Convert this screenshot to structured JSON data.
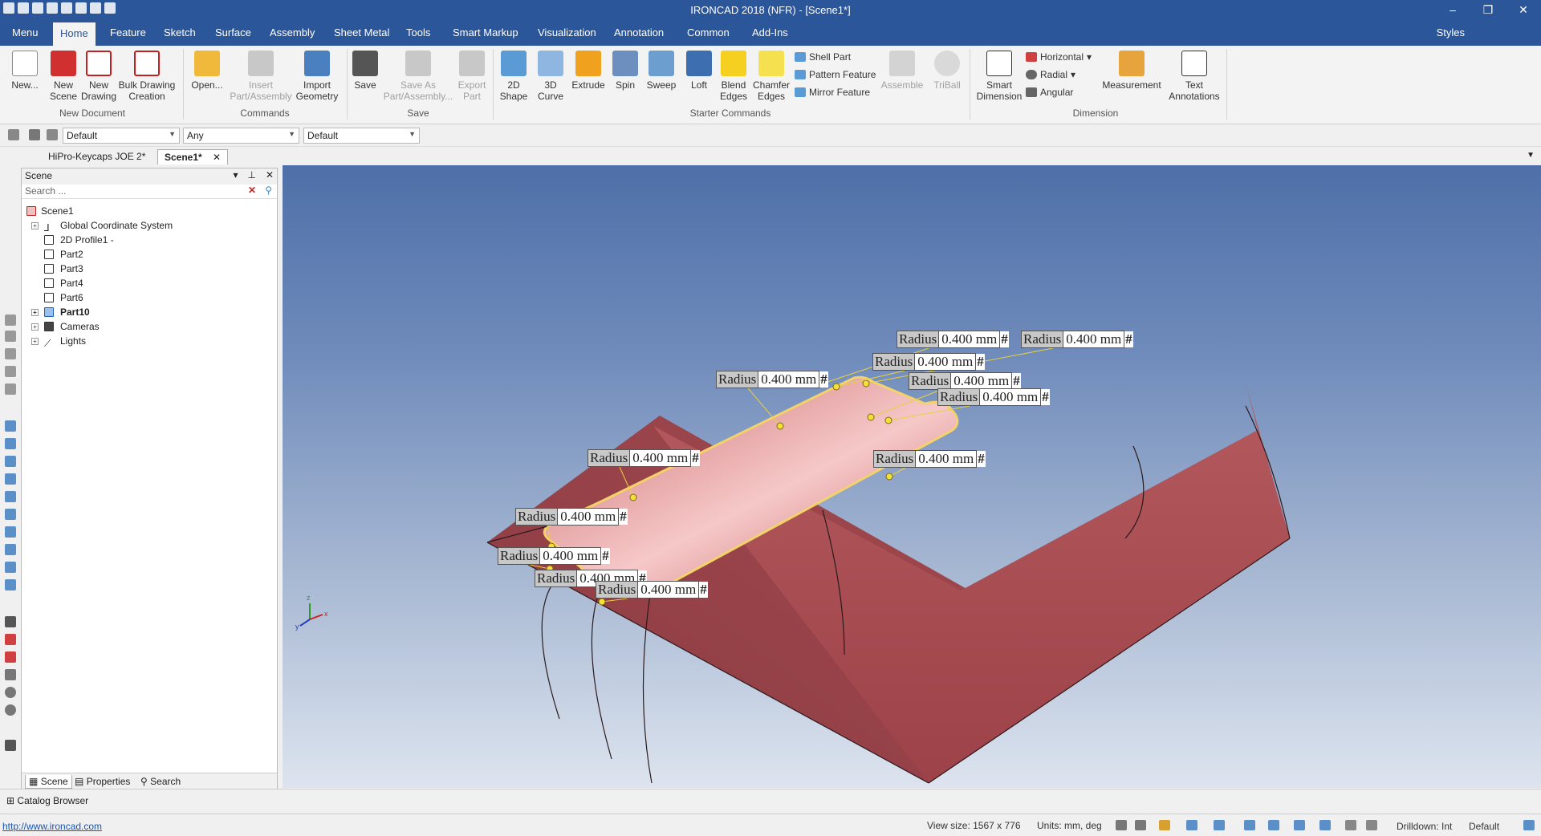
{
  "window": {
    "title": "IRONCAD 2018 (NFR) - [Scene1*]",
    "controls": [
      "–",
      "❐",
      "✕"
    ]
  },
  "menu": {
    "tabs": [
      "Menu",
      "Home",
      "Feature",
      "Sketch",
      "Surface",
      "Assembly",
      "Sheet Metal",
      "Tools",
      "Smart Markup",
      "Visualization",
      "Annotation",
      "Common",
      "Add-Ins"
    ],
    "active": "Home",
    "styles": "Styles"
  },
  "ribbon": {
    "new": "New...",
    "new_scene": "New Scene",
    "new_drawing": "New Drawing",
    "bulk": "Bulk Drawing Creation",
    "group_new": "New Document",
    "open": "Open...",
    "insert": "Insert Part/Assembly",
    "import": "Import Geometry",
    "group_commands": "Commands",
    "save": "Save",
    "save_as": "Save As Part/Assembly...",
    "export": "Export Part",
    "group_save": "Save",
    "shape2d": "2D Shape",
    "curve3d": "3D Curve",
    "extrude": "Extrude",
    "spin": "Spin",
    "sweep": "Sweep",
    "loft": "Loft",
    "blend": "Blend Edges",
    "chamfer": "Chamfer Edges",
    "shell": "Shell Part",
    "pattern": "Pattern Feature",
    "mirror": "Mirror Feature",
    "assemble": "Assemble",
    "triball": "TriBall",
    "group_starter": "Starter Commands",
    "smart_dim": "Smart Dimension",
    "horizontal": "Horizontal",
    "radial": "Radial",
    "angular": "Angular",
    "measurement": "Measurement",
    "text_ann": "Text Annotations",
    "group_dim": "Dimension"
  },
  "selection": {
    "combo1": "Default",
    "combo2": "Any",
    "combo3": "Default"
  },
  "docs": {
    "tab1": "HiPro-Keycaps JOE 2*",
    "tab2": "Scene1*"
  },
  "panel": {
    "title": "Scene",
    "search_placeholder": "Search ...",
    "tabs": [
      "Scene",
      "Properties",
      "Search"
    ],
    "tree": [
      {
        "label": "Scene1",
        "level": 0,
        "bold": false,
        "expand": false
      },
      {
        "label": "Global Coordinate System",
        "level": 1,
        "bold": false,
        "expand": true
      },
      {
        "label": "2D Profile1 -",
        "level": 1,
        "bold": false,
        "expand": false
      },
      {
        "label": "Part2",
        "level": 1,
        "bold": false,
        "expand": false
      },
      {
        "label": "Part3",
        "level": 1,
        "bold": false,
        "expand": false
      },
      {
        "label": "Part4",
        "level": 1,
        "bold": false,
        "expand": false
      },
      {
        "label": "Part6",
        "level": 1,
        "bold": false,
        "expand": false
      },
      {
        "label": "Part10",
        "level": 1,
        "bold": true,
        "expand": true
      },
      {
        "label": "Cameras",
        "level": 1,
        "bold": false,
        "expand": true
      },
      {
        "label": "Lights",
        "level": 1,
        "bold": false,
        "expand": true
      }
    ]
  },
  "callouts": {
    "label": "Radius",
    "value": "0.400 mm",
    "hash": "#",
    "count": 12
  },
  "axes": {
    "x": "x",
    "y": "y",
    "z": "z"
  },
  "catalog": "Catalog Browser",
  "status": {
    "url": "http://www.ironcad.com",
    "view_size": "View size: 1567 x 776",
    "units": "Units: mm, deg",
    "drilldown": "Drilldown: Int",
    "style": "Default"
  },
  "colors": {
    "brand": "#2b579a",
    "part": "#b35a5e",
    "edge": "#f3d26a"
  }
}
